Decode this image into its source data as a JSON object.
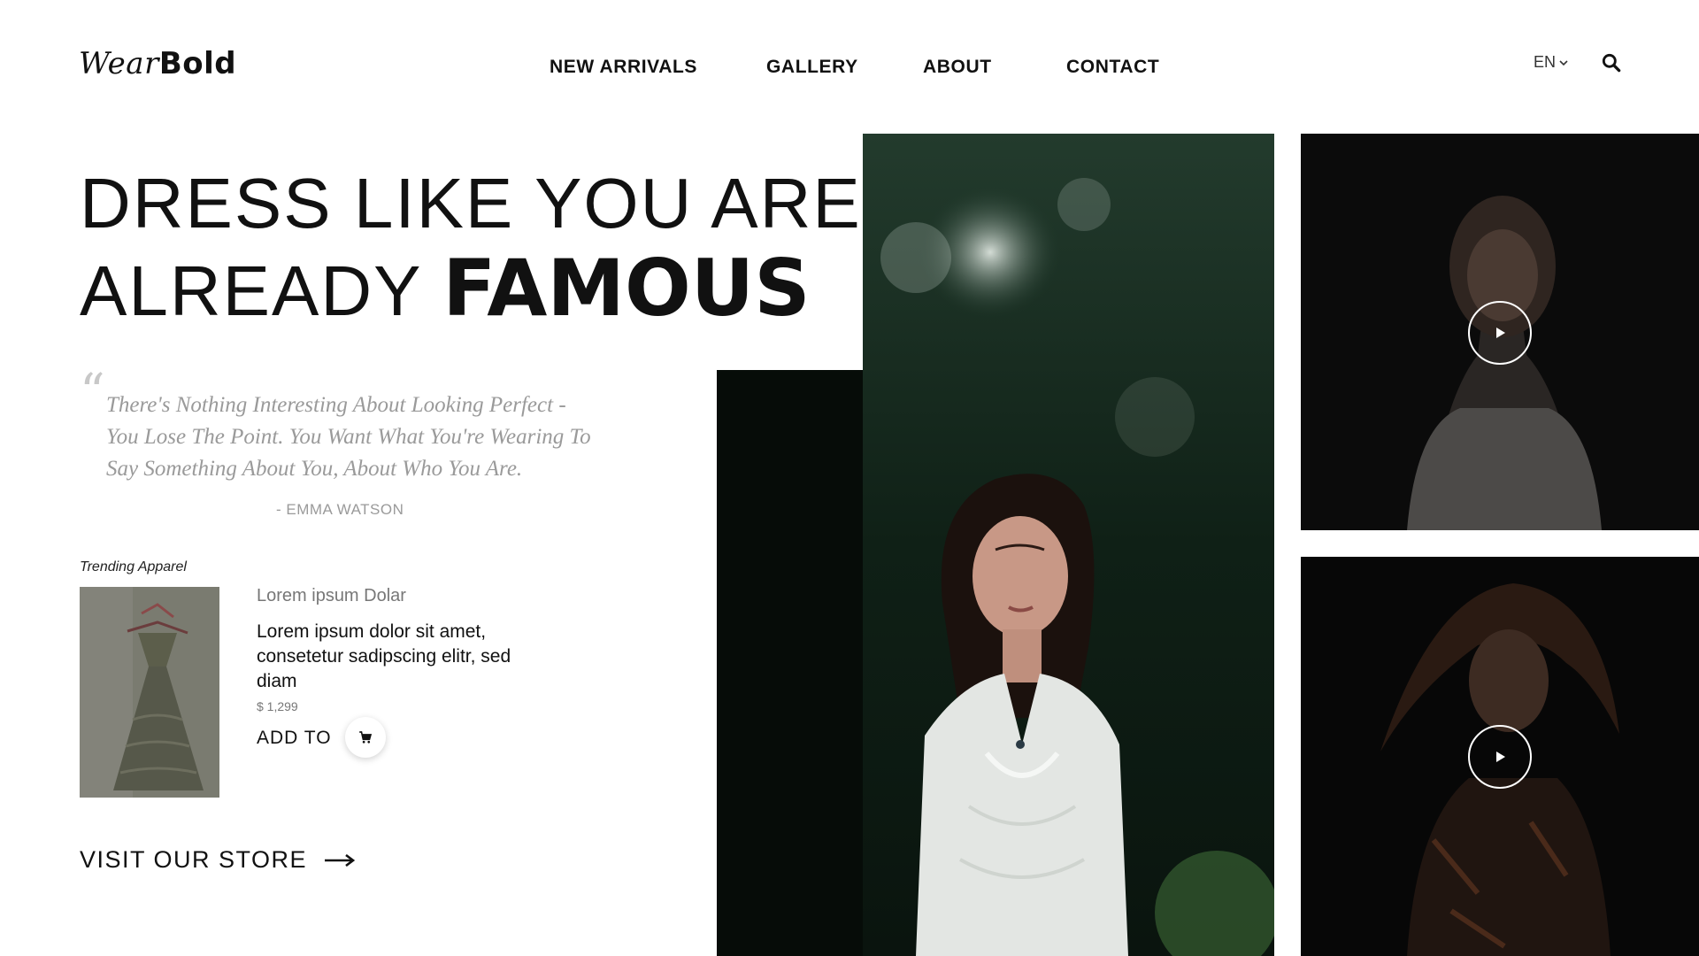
{
  "header": {
    "logo_light": "Wear",
    "logo_bold": "Bold",
    "nav": [
      "NEW ARRIVALS",
      "GALLERY",
      "ABOUT",
      "CONTACT"
    ],
    "language": "EN"
  },
  "hero": {
    "line1": "DRESS LIKE YOU ARE",
    "line2": "ALREADY",
    "line2_strong": "FAMOUS"
  },
  "quote": {
    "text": "There's Nothing Interesting About Looking Perfect - You Lose The Point. You Want What You're Wearing To Say Something About You, About Who You Are.",
    "author": "- EMMA WATSON"
  },
  "trending": {
    "label": "Trending Apparel",
    "product_title": "Lorem ipsum Dolar",
    "product_desc": "Lorem ipsum dolor sit amet, consetetur sadipscing elitr, sed diam",
    "price": "$ 1,299",
    "add_to": "ADD TO"
  },
  "visit_store": "VISIT OUR STORE",
  "icons": {
    "search": "search-icon",
    "chevron": "chevron-down-icon",
    "cart": "cart-icon",
    "arrow": "arrow-right-icon",
    "play": "play-icon"
  },
  "colors": {
    "text": "#111111",
    "muted": "#9a9a9a",
    "background": "#ffffff"
  }
}
